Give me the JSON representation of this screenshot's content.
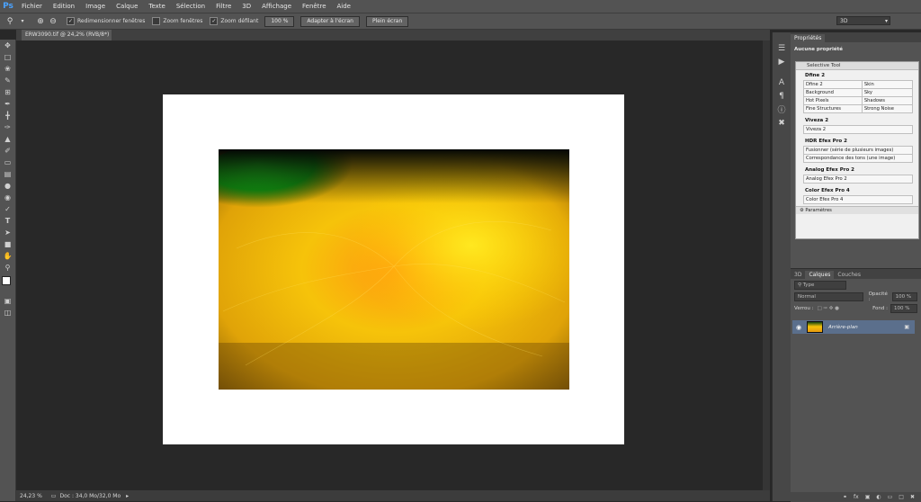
{
  "app": {
    "logo": "Ps"
  },
  "menu": [
    "Fichier",
    "Edition",
    "Image",
    "Calque",
    "Texte",
    "Sélection",
    "Filtre",
    "3D",
    "Affichage",
    "Fenêtre",
    "Aide"
  ],
  "options": {
    "resize_windows": "Redimensionner fenêtres",
    "zoom_windows": "Zoom fenêtres",
    "scrubby_zoom": "Zoom défilant",
    "zoom_level_button": "100 %",
    "fit_screen_button": "Adapter à l'écran",
    "fill_screen_button": "Plein écran",
    "workspace": "3D",
    "resize_windows_checked": true,
    "zoom_windows_checked": false,
    "scrubby_zoom_checked": true
  },
  "document": {
    "tab_title": "ERW3090.tif @ 24,2% (RVB/8*) *",
    "zoom": "24,23 %",
    "doc_info": "Doc : 34,0 Mo/32,0 Mo"
  },
  "properties": {
    "tab": "Propriétés",
    "empty_label": "Aucune propriété"
  },
  "selective_tool": {
    "title": "Selective Tool",
    "params_label": "Paramètres",
    "groups": [
      {
        "name": "Dfine 2",
        "rows": [
          [
            "Dfine 2",
            "Skin"
          ],
          [
            "Background",
            "Sky"
          ],
          [
            "Hot Pixels",
            "Shadows"
          ],
          [
            "Fine Structures",
            "Strong Noise"
          ]
        ]
      },
      {
        "name": "Viveza 2",
        "items": [
          "Viveza 2"
        ]
      },
      {
        "name": "HDR Efex Pro 2",
        "items": [
          "Fusionner (série de plusieurs images)",
          "Correspondance des tons (une image)"
        ]
      },
      {
        "name": "Analog Efex Pro 2",
        "items": [
          "Analog Efex Pro 2"
        ]
      },
      {
        "name": "Color Efex Pro 4",
        "items": [
          "Color Efex Pro 4"
        ]
      }
    ]
  },
  "layers": {
    "tabs": [
      "3D",
      "Calques",
      "Couches"
    ],
    "active_tab": "Calques",
    "filter_type": "Type",
    "blend_mode": "Normal",
    "opacity_label": "Opacité :",
    "opacity_value": "100 %",
    "lock_label": "Verrou :",
    "fill_label": "Fond :",
    "fill_value": "100 %",
    "layer_name": "Arrière-plan"
  },
  "colors": {
    "accent": "#4aa3ff",
    "selected_layer": "#5b6f8c"
  }
}
